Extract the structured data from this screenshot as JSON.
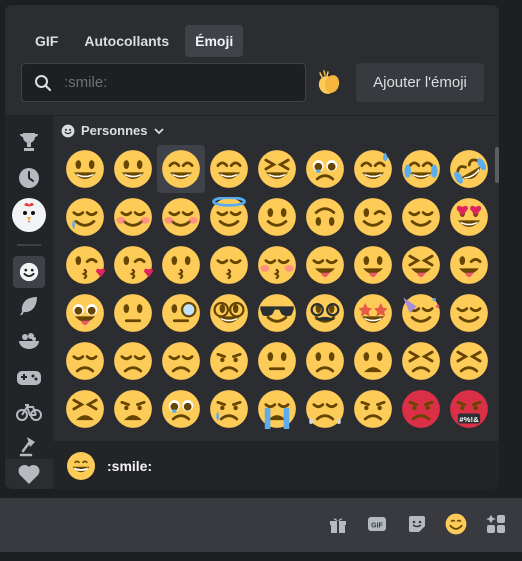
{
  "tabs": [
    {
      "label": "GIF",
      "active": false
    },
    {
      "label": "Autocollants",
      "active": false
    },
    {
      "label": "Émoji",
      "active": true
    }
  ],
  "search": {
    "placeholder": ":smile:",
    "value": ""
  },
  "add_emoji_label": "Ajouter l'émoji",
  "category": {
    "label": "Personnes"
  },
  "footer": {
    "label": ":smile:"
  },
  "sidebar": [
    "trophy-icon",
    "clock-icon",
    "chicken-server-icon",
    "smile-icon",
    "leaf-icon",
    "food-icon",
    "gamepad-icon",
    "bicycle-icon",
    "lamp-icon",
    "heart-icon"
  ],
  "chatbar_icons": [
    "gift-icon",
    "gif-icon",
    "sticker-icon",
    "emoji-icon",
    "apps-icon"
  ],
  "colors": {
    "background": "#1e1f22",
    "panel": "#2b2d31",
    "sidebar": "#232428",
    "emoji_yellow": "#fdcb58",
    "emoji_dark": "#664500",
    "red_face": "#da2f47"
  },
  "emoji_rows": [
    [
      "grinning",
      "smiley",
      "smile",
      "grin",
      "laughing",
      "holding-back-tears",
      "sweat-smile",
      "joy",
      "rofl"
    ],
    [
      "smiling-face-with-tear",
      "blush-hearts",
      "blush",
      "innocent",
      "slight-smile",
      "upside-down",
      "wink",
      "relieved",
      "heart-eyes"
    ],
    [
      "face-blowing-kiss",
      "kissing-heart",
      "kissing",
      "kissing-closed-eyes",
      "kissing-smiling-eyes",
      "yum",
      "tongue-out",
      "squinting-tongue",
      "winking-tongue"
    ],
    [
      "zany",
      "raised-eyebrow",
      "monocle",
      "nerd",
      "sunglasses",
      "disguised",
      "star-struck",
      "partying",
      "smirk"
    ],
    [
      "unamused",
      "disappointed",
      "pensive",
      "worried",
      "confused",
      "slight-frown",
      "frowning",
      "persevere",
      "confounded"
    ],
    [
      "tired",
      "weary",
      "pleading",
      "crying",
      "sob",
      "steam",
      "angry",
      "rage",
      "cursing"
    ]
  ]
}
